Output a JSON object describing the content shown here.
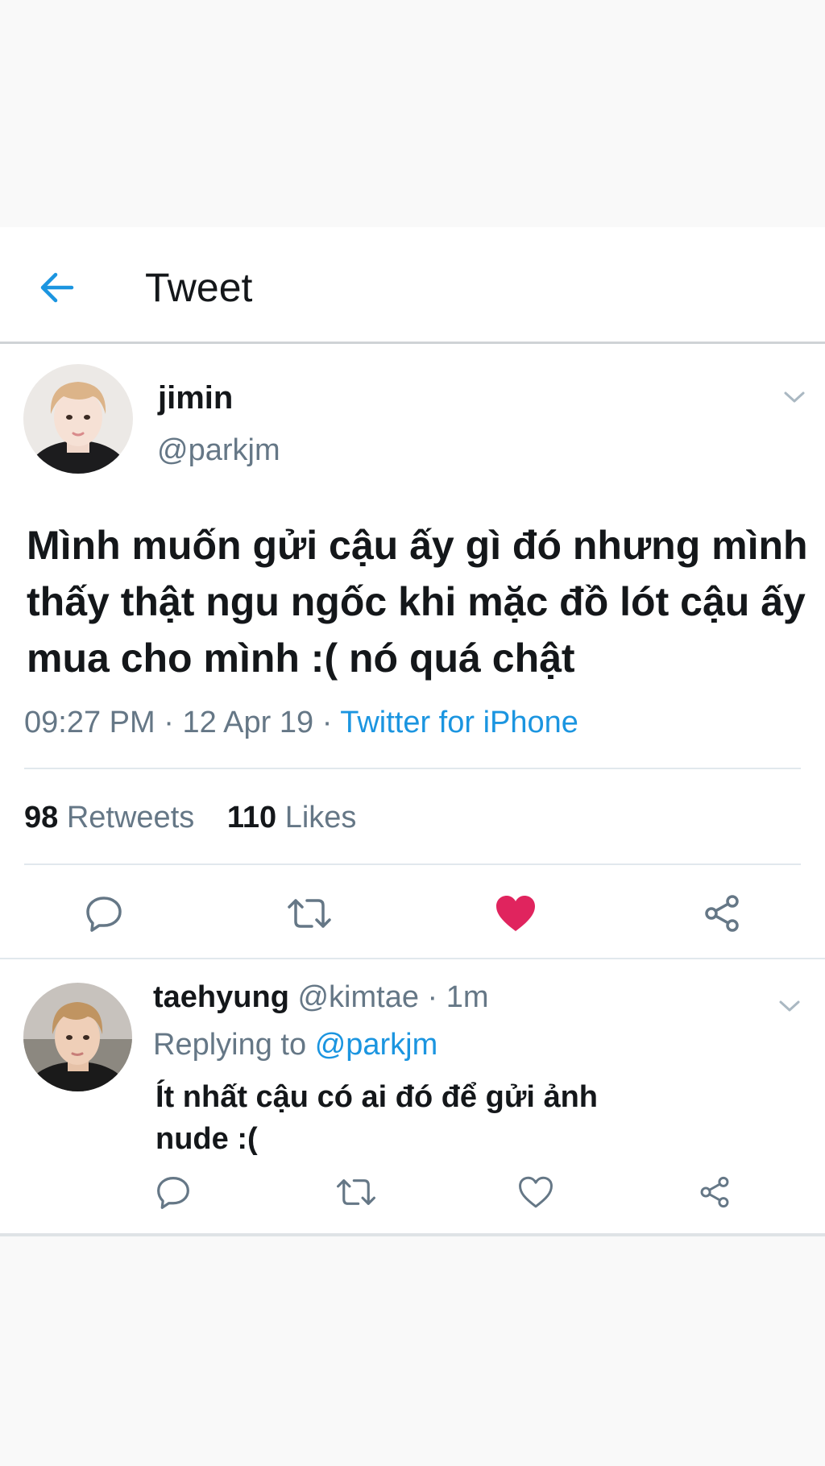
{
  "header": {
    "title": "Tweet"
  },
  "tweet": {
    "name": "jimin",
    "handle": "@parkjm",
    "text": "Mình muốn gửi cậu ấy gì đó nhưng mình thấy thật ngu ngốc khi mặc đồ lót cậu ấy mua cho mình :( nó quá chật",
    "time": "09:27 PM",
    "date": "12 Apr 19",
    "separator": "·",
    "source": "Twitter for iPhone",
    "retweet_count": "98",
    "retweet_label": "Retweets",
    "like_count": "110",
    "like_label": "Likes",
    "liked": true
  },
  "reply": {
    "name": "taehyung",
    "handle": "@kimtae",
    "time": "1m",
    "separator": "·",
    "replying_label": "Replying to",
    "replying_to": "@parkjm",
    "text": "Ít nhất cậu có ai đó để gửi ảnh nude :("
  },
  "colors": {
    "accent": "#1b95e0",
    "like": "#e0245e",
    "secondary_text": "#657786",
    "primary_text": "#14171a"
  },
  "icons": {
    "back": "back-arrow-icon",
    "caret": "chevron-down-icon",
    "reply": "reply-icon",
    "retweet": "retweet-icon",
    "like": "heart-icon",
    "share": "share-icon"
  }
}
